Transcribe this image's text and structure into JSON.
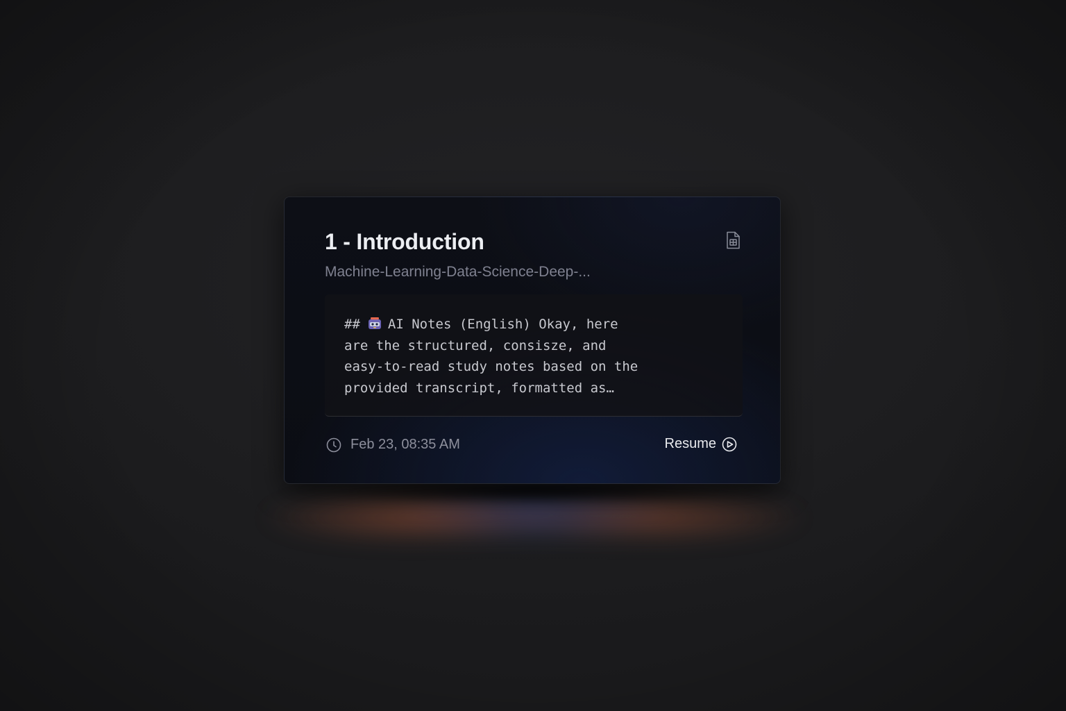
{
  "card": {
    "title": "1 - Introduction",
    "subtitle": "Machine-Learning-Data-Science-Deep-...",
    "preview_prefix": "##",
    "preview_emoji": "robot-face-icon",
    "preview_text": "AI Notes (English) Okay, here\nare the structured, consisze, and\neasy-to-read study notes based on the\nprovided transcript, formatted as…",
    "timestamp": "Feb 23, 08:35 AM",
    "resume_label": "Resume",
    "icons": {
      "document": "document-icon",
      "clock": "clock-icon",
      "resume": "play-circle-icon"
    }
  },
  "colors": {
    "background": "#1f1f21",
    "card": "#0c0e15",
    "title": "#eceef2",
    "subtitle": "#7f8190",
    "body_text": "#c8c9cf"
  }
}
